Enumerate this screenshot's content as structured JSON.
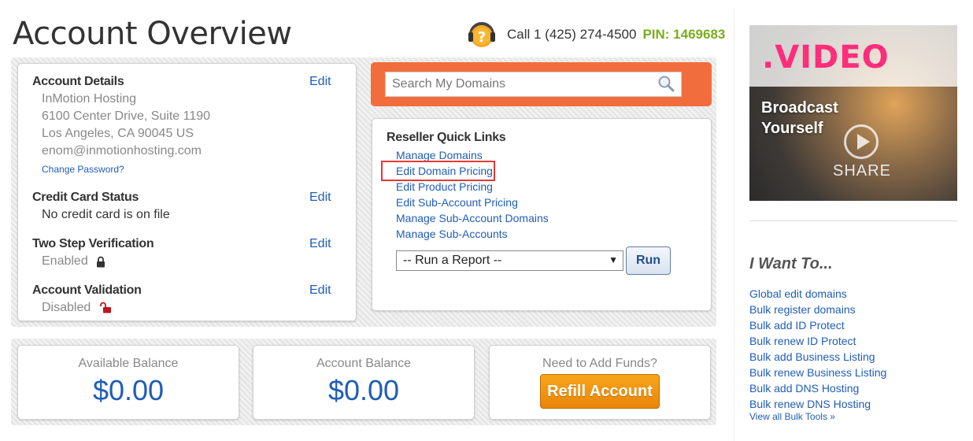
{
  "page": {
    "title": "Account Overview"
  },
  "support": {
    "call_text": "Call 1 (425) 274-4500",
    "pin_text": "PIN: 1469683"
  },
  "account_details": {
    "title": "Account Details",
    "edit_label": "Edit",
    "address_lines": [
      "InMotion Hosting",
      "6100 Center Drive, Suite 1190",
      "Los Angeles, CA 90045 US",
      "enom@inmotionhosting.com"
    ],
    "change_password_label": "Change Password?"
  },
  "credit_card": {
    "title": "Credit Card Status",
    "edit_label": "Edit",
    "status": "No credit card is on file"
  },
  "two_step": {
    "title": "Two Step Verification",
    "edit_label": "Edit",
    "status": "Enabled",
    "icon": "lock-icon"
  },
  "validation": {
    "title": "Account Validation",
    "edit_label": "Edit",
    "status": "Disabled",
    "icon": "unlock-icon"
  },
  "search": {
    "placeholder": "Search My Domains"
  },
  "quick_links": {
    "title": "Reseller Quick Links",
    "items": [
      "Manage Domains",
      "Edit Domain Pricing",
      "Edit Product Pricing",
      "Edit Sub-Account Pricing",
      "Manage Sub-Account Domains",
      "Manage Sub-Accounts"
    ],
    "highlighted_item": "Edit Domain Pricing",
    "report_select_value": "-- Run a Report --",
    "run_label": "Run"
  },
  "balances": {
    "available_label": "Available Balance",
    "available_value": "$0.00",
    "account_label": "Account Balance",
    "account_value": "$0.00",
    "funds_label": "Need to Add Funds?",
    "refill_label": "Refill Account"
  },
  "ad": {
    "logo": ".VIDEO",
    "headline": "Broadcast Yourself",
    "share": "SHARE"
  },
  "iwant": {
    "title": "I Want To...",
    "links": [
      "Global edit domains",
      "Bulk register domains",
      "Bulk add ID Protect",
      "Bulk renew ID Protect",
      "Bulk add Business Listing",
      "Bulk renew Business Listing",
      "Bulk add DNS Hosting",
      "Bulk renew DNS Hosting"
    ],
    "more_label": "View all Bulk Tools »"
  },
  "colors": {
    "link": "#1f5db8",
    "pin": "#7bac1e",
    "search_panel": "#f26d3d",
    "refill": "#f39a12",
    "highlight": "#e53935"
  }
}
